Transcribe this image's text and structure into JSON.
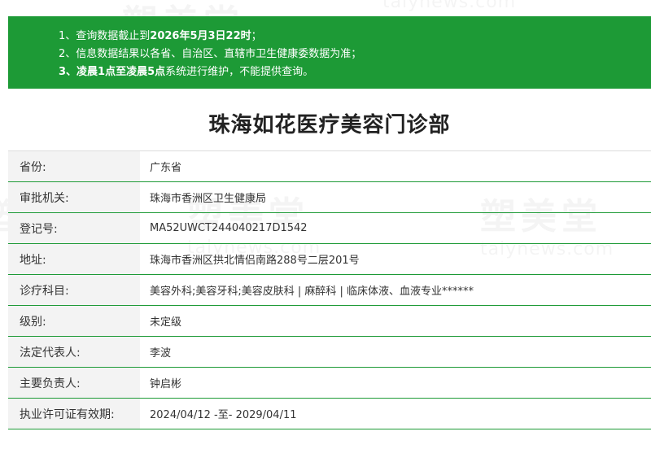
{
  "notice": {
    "lines": [
      {
        "prefix": "1、查询数据截止到",
        "strong": "2026年5月3日22时",
        "suffix": "；"
      },
      {
        "prefix": "2、信息数据结果以各省、自治区、直辖市卫生健康委数据为准；",
        "strong": "",
        "suffix": ""
      },
      {
        "prefix": "3、",
        "strong": "凌晨1点至凌晨5点",
        "suffix": "系统进行维护，不能提供查询。"
      }
    ]
  },
  "title": "珠海如花医疗美容门诊部",
  "rows": [
    {
      "label": "省份:",
      "value": "广东省"
    },
    {
      "label": "审批机关:",
      "value": "珠海市香洲区卫生健康局"
    },
    {
      "label": "登记号:",
      "value": "MA52UWCT244040217D1542"
    },
    {
      "label": "地址:",
      "value": "珠海市香洲区拱北情侣南路288号二层201号"
    },
    {
      "label": "诊疗科目:",
      "value": "美容外科;美容牙科;美容皮肤科 | 麻醉科 | 临床体液、血液专业******"
    },
    {
      "label": "级别:",
      "value": "未定级"
    },
    {
      "label": "法定代表人:",
      "value": "李波"
    },
    {
      "label": "主要负责人:",
      "value": "钟启彬"
    },
    {
      "label": "执业许可证有效期:",
      "value": "2024/04/12 -至- 2029/04/11"
    }
  ],
  "watermark": {
    "cn": "塑美堂",
    "url": "talynews.com"
  }
}
